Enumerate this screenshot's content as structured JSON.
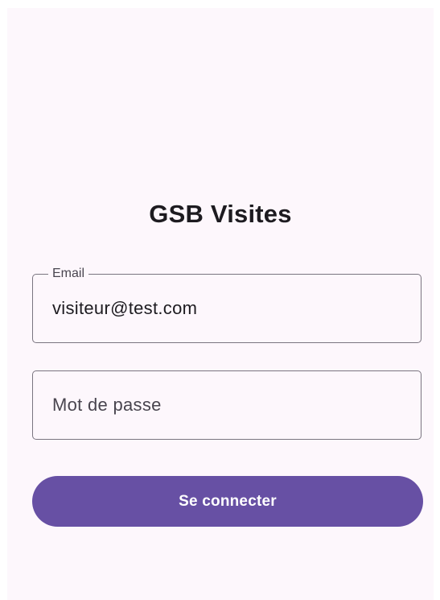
{
  "app": {
    "title": "GSB Visites"
  },
  "login_form": {
    "email": {
      "label": "Email",
      "value": "visiteur@test.com"
    },
    "password": {
      "placeholder": "Mot de passe",
      "value": ""
    },
    "submit_label": "Se connecter"
  },
  "colors": {
    "background": "#fdf7fc",
    "primary": "#6750a4",
    "outline": "#7a7580",
    "text": "#1d1b20"
  }
}
